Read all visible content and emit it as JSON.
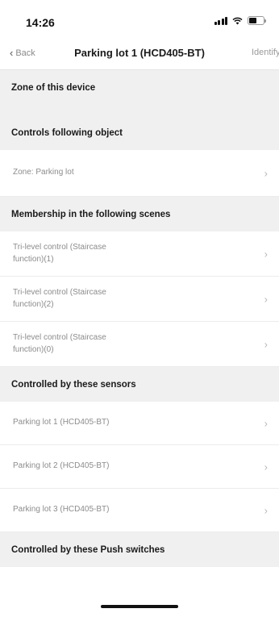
{
  "status_bar": {
    "time": "14:26",
    "icons": [
      "signal-icon",
      "wifi-icon",
      "battery-icon"
    ]
  },
  "nav": {
    "back_label": "Back",
    "title": "Parking lot 1 (HCD405-BT)",
    "action_label": "Identify"
  },
  "sections": {
    "zone_header": "Zone of this device",
    "controls_header": "Controls following object",
    "controls_items": [
      "Zone: Parking lot"
    ],
    "scenes_header": "Membership in the following scenes",
    "scenes_items": [
      "Tri-level control (Staircase function)(1)",
      "Tri-level control (Staircase function)(2)",
      "Tri-level control (Staircase function)(0)"
    ],
    "sensors_header": "Controlled by these sensors",
    "sensors_items": [
      "Parking lot 1 (HCD405-BT)",
      "Parking lot 2 (HCD405-BT)",
      "Parking lot 3 (HCD405-BT)"
    ],
    "push_header": "Controlled by these Push switches"
  },
  "colors": {
    "section_bg": "#f0f0f0",
    "row_text": "#8c8c8c",
    "chevron": "#b8b8b8"
  }
}
